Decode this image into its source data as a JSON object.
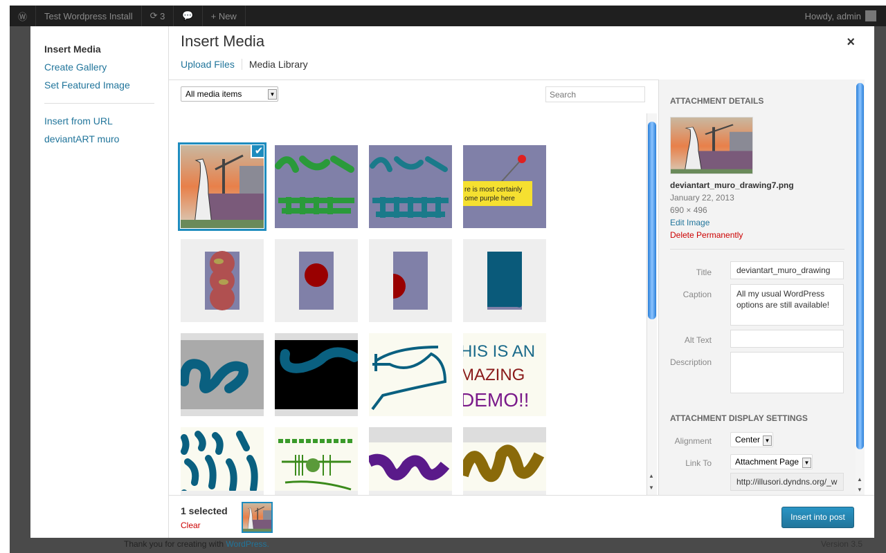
{
  "adminbar": {
    "site": "Test Wordpress Install",
    "updates": "3",
    "new": "New",
    "howdy": "Howdy, admin"
  },
  "background": {
    "footer_text": "Thank you for creating with ",
    "footer_link": "WordPress.",
    "version": "Version 3.5"
  },
  "menu": {
    "items": [
      "Insert Media",
      "Create Gallery",
      "Set Featured Image"
    ],
    "items2": [
      "Insert from URL",
      "deviantART muro"
    ]
  },
  "modal": {
    "title": "Insert Media",
    "close": "×",
    "tabs": [
      "Upload Files",
      "Media Library"
    ]
  },
  "toolbar": {
    "filter": "All media items",
    "search_placeholder": "Search"
  },
  "media": {
    "selected_index": 0,
    "tile_text": [
      "re is most certainly",
      "ome purple here"
    ],
    "demo_text": [
      "HIS IS AN",
      "MAZING",
      "DEMO!!"
    ]
  },
  "details": {
    "heading": "ATTACHMENT DETAILS",
    "filename": "deviantart_muro_drawing7.png",
    "date": "January 22, 2013",
    "dimensions": "690 × 496",
    "edit": "Edit Image",
    "delete": "Delete Permanently",
    "title_label": "Title",
    "title": "deviantart_muro_drawing",
    "caption_label": "Caption",
    "caption": "All my usual WordPress options are still available!",
    "alt_label": "Alt Text",
    "alt": "",
    "desc_label": "Description",
    "desc": ""
  },
  "display": {
    "heading": "ATTACHMENT DISPLAY SETTINGS",
    "align_label": "Alignment",
    "align": "Center",
    "link_label": "Link To",
    "link": "Attachment Page",
    "url": "http://illusori.dyndns.org/_w"
  },
  "footer": {
    "selected": "1 selected",
    "clear": "Clear",
    "insert": "Insert into post"
  },
  "colors": {
    "accent": "#21759b",
    "danger": "#cc0000",
    "selection": "#1e8cbe"
  }
}
